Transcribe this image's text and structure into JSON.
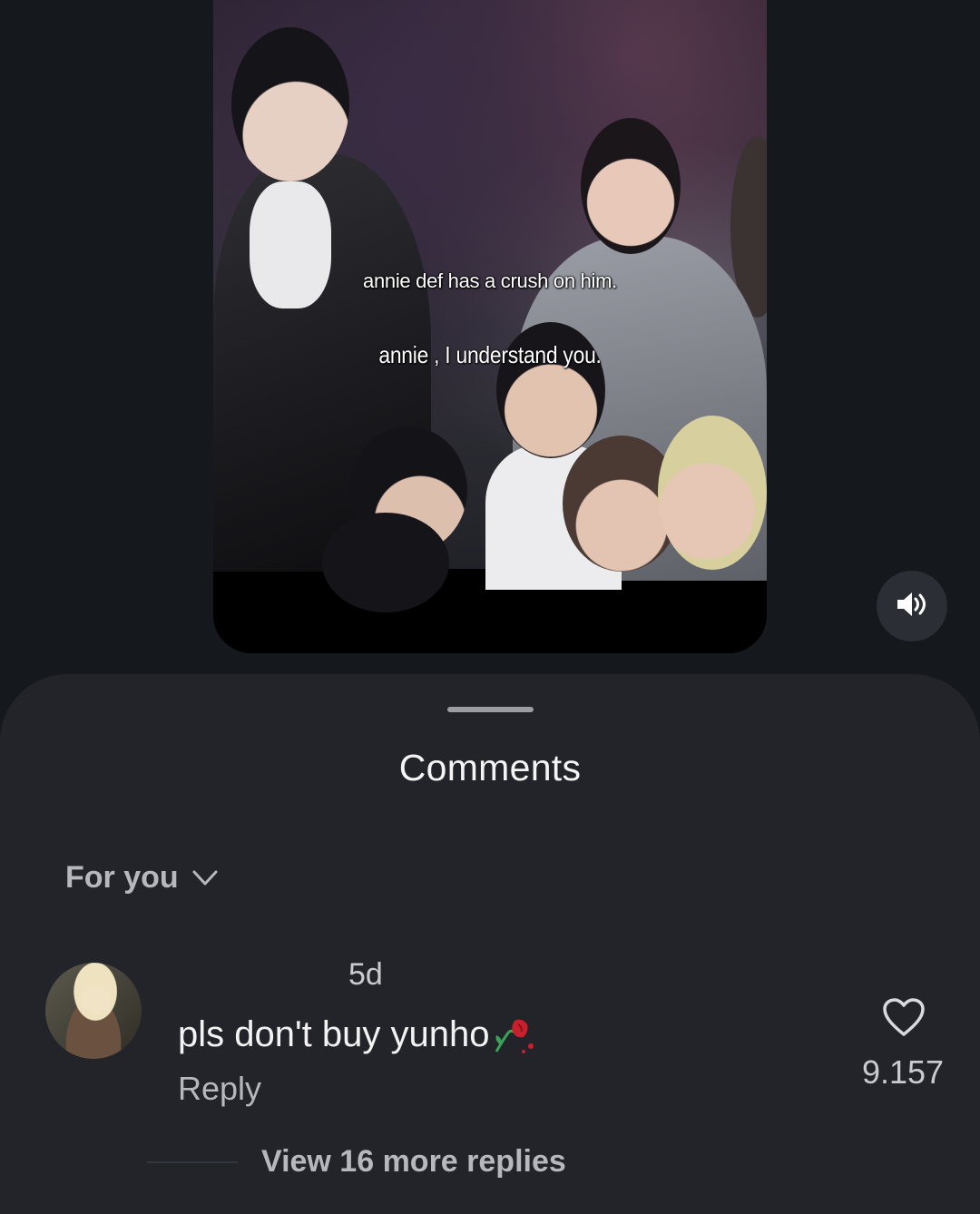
{
  "video": {
    "captions": [
      "annie def has a crush on him.",
      "annie , I understand you."
    ],
    "volume_icon": "speaker-icon"
  },
  "comments_sheet": {
    "title": "Comments",
    "sort_label": "For you",
    "sort_icon": "chevron-down-icon"
  },
  "comment": {
    "time": "5d",
    "text": "pls don't buy yunho",
    "emoji": "wilted-rose",
    "reply_label": "Reply",
    "like_icon": "heart-outline-icon",
    "like_count": "9.157",
    "view_replies_label": "View 16 more replies"
  },
  "colors": {
    "background": "#15181d",
    "sheet": "#222429",
    "secondary_text": "#b6b8bd"
  }
}
